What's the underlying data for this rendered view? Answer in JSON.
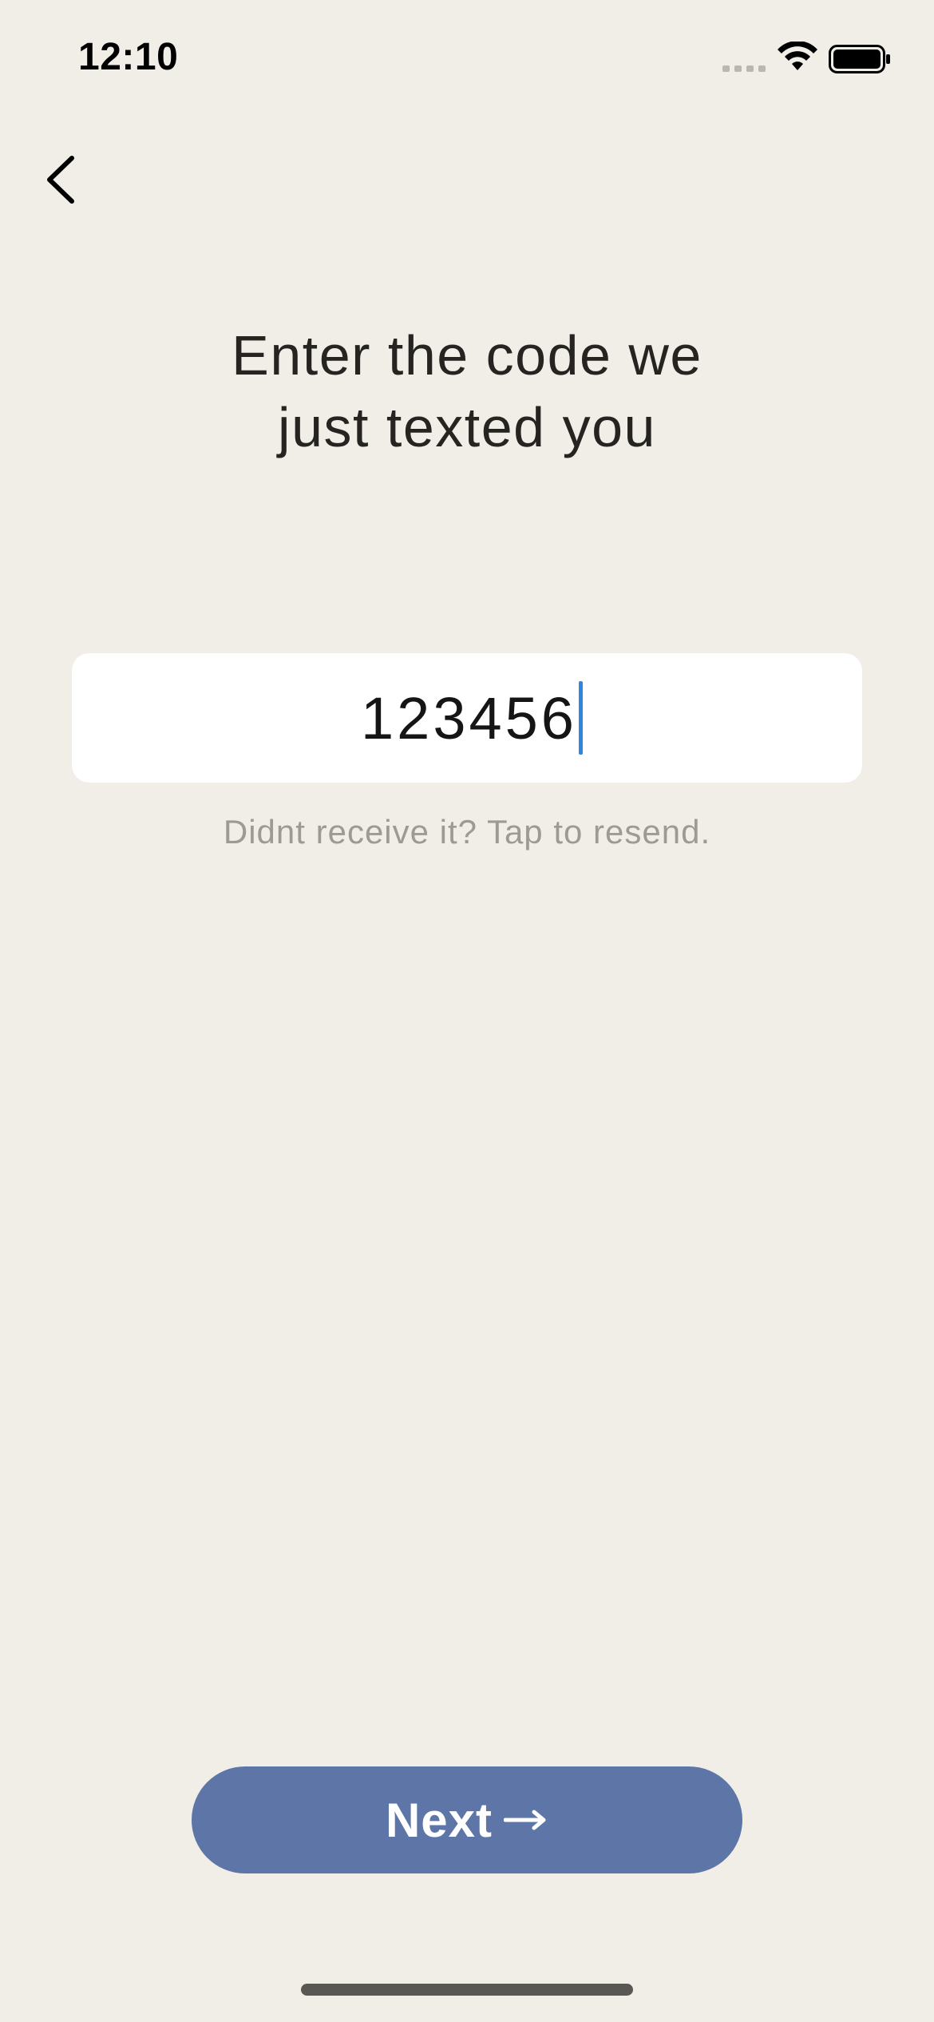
{
  "status_bar": {
    "time": "12:10",
    "icons": [
      "signal-icon",
      "wifi-icon",
      "battery-icon"
    ]
  },
  "navigation": {
    "back_icon": "chevron-left-icon"
  },
  "main": {
    "title": "Enter the code we just texted you",
    "code_input": {
      "value": "123456"
    },
    "resend_text": "Didnt receive it? Tap to resend."
  },
  "footer": {
    "next_label": "Next",
    "next_icon": "arrow-right-icon"
  },
  "colors": {
    "background": "#f1eee7",
    "primary_button": "#5e76a7",
    "cursor": "#2f86e0",
    "muted_text": "#9d9a95"
  }
}
